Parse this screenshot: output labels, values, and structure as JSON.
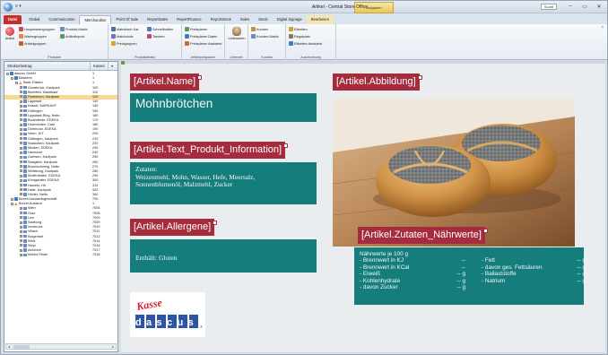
{
  "window": {
    "title": "Artikel - Central Store Office",
    "context_header": "Aufgaben",
    "search_label": "Sucht",
    "quick_access": "≡ ▾"
  },
  "tabs": [
    {
      "label": "Datei",
      "kind": "file"
    },
    {
      "label": "Global",
      "kind": "normal"
    },
    {
      "label": "Communication",
      "kind": "normal"
    },
    {
      "label": "Merchandise",
      "kind": "active"
    },
    {
      "label": "Point Of Sale",
      "kind": "normal"
    },
    {
      "label": "ReportSales",
      "kind": "normal"
    },
    {
      "label": "ReportFinance",
      "kind": "normal"
    },
    {
      "label": "ReportStock",
      "kind": "normal"
    },
    {
      "label": "Sales",
      "kind": "normal"
    },
    {
      "label": "Stock",
      "kind": "normal"
    },
    {
      "label": "Digital Signage",
      "kind": "normal"
    },
    {
      "label": "Bearbeiten",
      "kind": "ctx"
    }
  ],
  "ribbon": {
    "big_article_label": "Artikel",
    "produkte": {
      "items": [
        "Hauptwarengruppen",
        "Produkt-Matrix",
        "Warengruppen",
        "Artikelimport",
        "Artikelgruppen"
      ],
      "label": "Produkte"
    },
    "produktdetails": {
      "items": [
        "Matrixfach Kat.",
        "Schnellbatten",
        "Matchcode",
        "Tandem",
        "Preisgruppen"
      ],
      "label": "Produktdetails"
    },
    "preisplaner": {
      "items": [
        "Preisplaner",
        "Preisplaner Daten",
        "Preisplaner Assistent"
      ],
      "label": "Artikelpreisplaner"
    },
    "lieferant": {
      "big": "Lieferanten",
      "label": "Lieferant"
    },
    "kunden": {
      "items": [
        "Kunden",
        "Kunden-Matrix"
      ],
      "label": "Kunden"
    },
    "auszeichnung": {
      "items": [
        "Etiketten",
        "Regalplatz",
        "Etiketten Assistent"
      ],
      "label": "Auszeichnung"
    }
  },
  "tree": {
    "col_name": "Strukturbeitrag",
    "col_kassel": "Kassel",
    "col_toggle": "▾",
    "rows": [
      {
        "name": "dascus GmbH",
        "val": "1",
        "indent": 0,
        "icon": "house",
        "exp": "−"
      },
      {
        "name": "Bäckerei",
        "val": "1",
        "indent": 1,
        "icon": "house",
        "exp": "−"
      },
      {
        "name": "Back-Filialen",
        "val": "1",
        "indent": 2,
        "icon": "warn",
        "exp": "−"
      },
      {
        "name": "Osnabrück, Kaufpark",
        "val": "100",
        "indent": 3,
        "icon": "store",
        "exp": "+"
      },
      {
        "name": "Bielefeld, Marktkauf",
        "val": "110",
        "indent": 3,
        "icon": "store",
        "exp": "+"
      },
      {
        "name": "Paderborn, Kaufpark",
        "val": "120",
        "indent": 3,
        "icon": "store",
        "exp": "+",
        "sel": true
      },
      {
        "name": "Lippstadt",
        "val": "130",
        "indent": 3,
        "icon": "store",
        "exp": "+"
      },
      {
        "name": "Kassel, MARKANT",
        "val": "140",
        "indent": 3,
        "icon": "store",
        "exp": "+"
      },
      {
        "name": "Göttingen",
        "val": "150",
        "indent": 3,
        "icon": "store",
        "exp": "+"
      },
      {
        "name": "Lippstadt-Ring, Netto",
        "val": "160",
        "indent": 3,
        "icon": "store",
        "exp": "+"
      },
      {
        "name": "Bodenfelde, EDEKA",
        "val": "170",
        "indent": 3,
        "icon": "store",
        "exp": "+"
      },
      {
        "name": "Holzminden, Cafe",
        "val": "180",
        "indent": 3,
        "icon": "store",
        "exp": "+"
      },
      {
        "name": "Dortmund, EDEKA",
        "val": "190",
        "indent": 3,
        "icon": "store",
        "exp": "+"
      },
      {
        "name": "Velen, HIT",
        "val": "200",
        "indent": 3,
        "icon": "store",
        "exp": "+"
      },
      {
        "name": "Göttingen, Kaufpark",
        "val": "210",
        "indent": 3,
        "icon": "store",
        "exp": "+"
      },
      {
        "name": "Salzkotten, Kaufpark",
        "val": "220",
        "indent": 3,
        "icon": "store",
        "exp": "+"
      },
      {
        "name": "Minden, EDEKA",
        "val": "230",
        "indent": 3,
        "icon": "store",
        "exp": "+"
      },
      {
        "name": "Hannover",
        "val": "240",
        "indent": 3,
        "icon": "store",
        "exp": "+"
      },
      {
        "name": "Garbsen, Kaufpark",
        "val": "250",
        "indent": 3,
        "icon": "store",
        "exp": "+"
      },
      {
        "name": "Salzgitter, Kaufpark",
        "val": "260",
        "indent": 3,
        "icon": "store",
        "exp": "+"
      },
      {
        "name": "Braunschweig, Netto",
        "val": "270",
        "indent": 3,
        "icon": "store",
        "exp": "+"
      },
      {
        "name": "Wolfsburg, Kaufpark",
        "val": "280",
        "indent": 3,
        "icon": "store",
        "exp": "+"
      },
      {
        "name": "Wolfenbüttel, EDEKA",
        "val": "290",
        "indent": 3,
        "icon": "store",
        "exp": "+"
      },
      {
        "name": "Königslutter, EDEKA",
        "val": "300",
        "indent": 3,
        "icon": "store",
        "exp": "+"
      },
      {
        "name": "Hameln, Hit",
        "val": "310",
        "indent": 3,
        "icon": "store",
        "exp": "+"
      },
      {
        "name": "Halle, Kaufpark",
        "val": "320",
        "indent": 3,
        "icon": "store",
        "exp": "+"
      },
      {
        "name": "Höxter, Netto",
        "val": "340",
        "indent": 3,
        "icon": "store",
        "exp": "+"
      },
      {
        "name": "Bexeel Auslandsgeschäft",
        "val": "700",
        "indent": 1,
        "icon": "house",
        "exp": "−"
      },
      {
        "name": "Brezel-Ausland",
        "val": "1",
        "indent": 1,
        "icon": "warn",
        "exp": "−"
      },
      {
        "name": "Wien",
        "val": "7004",
        "indent": 3,
        "icon": "store",
        "exp": "+"
      },
      {
        "name": "Graz",
        "val": "7008",
        "indent": 3,
        "icon": "store",
        "exp": "+"
      },
      {
        "name": "Linz",
        "val": "7009",
        "indent": 3,
        "icon": "store",
        "exp": "+"
      },
      {
        "name": "Salzburg",
        "val": "7009",
        "indent": 3,
        "icon": "store",
        "exp": "+"
      },
      {
        "name": "Innsbruck",
        "val": "7010",
        "indent": 3,
        "icon": "store",
        "exp": "+"
      },
      {
        "name": "Villach",
        "val": "7011",
        "indent": 3,
        "icon": "store",
        "exp": "+"
      },
      {
        "name": "Klagenfurt",
        "val": "7012",
        "indent": 3,
        "icon": "store",
        "exp": "+"
      },
      {
        "name": "Wels",
        "val": "7014",
        "indent": 3,
        "icon": "store",
        "exp": "+"
      },
      {
        "name": "Steyr",
        "val": "7016",
        "indent": 3,
        "icon": "store",
        "exp": "+"
      },
      {
        "name": "Aeldorch",
        "val": "7017",
        "indent": 3,
        "icon": "store",
        "exp": "+"
      },
      {
        "name": "Mobile Filiale",
        "val": "7018",
        "indent": 3,
        "icon": "store",
        "exp": "+"
      }
    ]
  },
  "canvas": {
    "name_field": "[Artikel.Name]",
    "name_value": "Mohnbrötchen",
    "text_field": "[Artikel.Text_Produkt_Information]",
    "text_lines": [
      "Zutaten:",
      "Weizenmehl, Mohn, Wasser, Hefe, Meersalz,",
      "Sonnenblumenöl, Malzmehl, Zucker"
    ],
    "allergen_field": "[Artikel.Allergene]",
    "allergen_value": "Enthält:  Gluten",
    "image_field": "[Artikel.Abbildung]",
    "naehr_field": "[Artikel.Zutaten_Nährwerte]",
    "naehr_title": "Nährwerte je 100 g",
    "naehr_left": [
      {
        "label": "- Brennwert in KJ",
        "val": "--"
      },
      {
        "label": "- Brennwert in KCal",
        "val": "--"
      },
      {
        "label": "- Eiweiß",
        "val": "-- g"
      },
      {
        "label": "- Kohlenhydrate",
        "val": "-- g"
      },
      {
        "label": "- davon Zucker",
        "val": "-- g"
      }
    ],
    "naehr_right": [
      {
        "label": "- Fett",
        "val": "-- g"
      },
      {
        "label": "- davon ges. Fettsäuren",
        "val": "-- g"
      },
      {
        "label": "- Ballaststoffe",
        "val": "-- g"
      },
      {
        "label": "- Natrium",
        "val": "-- g"
      }
    ],
    "logo_top": "Kasse",
    "logo_bottom": "dascus",
    "logo_mark": "®"
  }
}
